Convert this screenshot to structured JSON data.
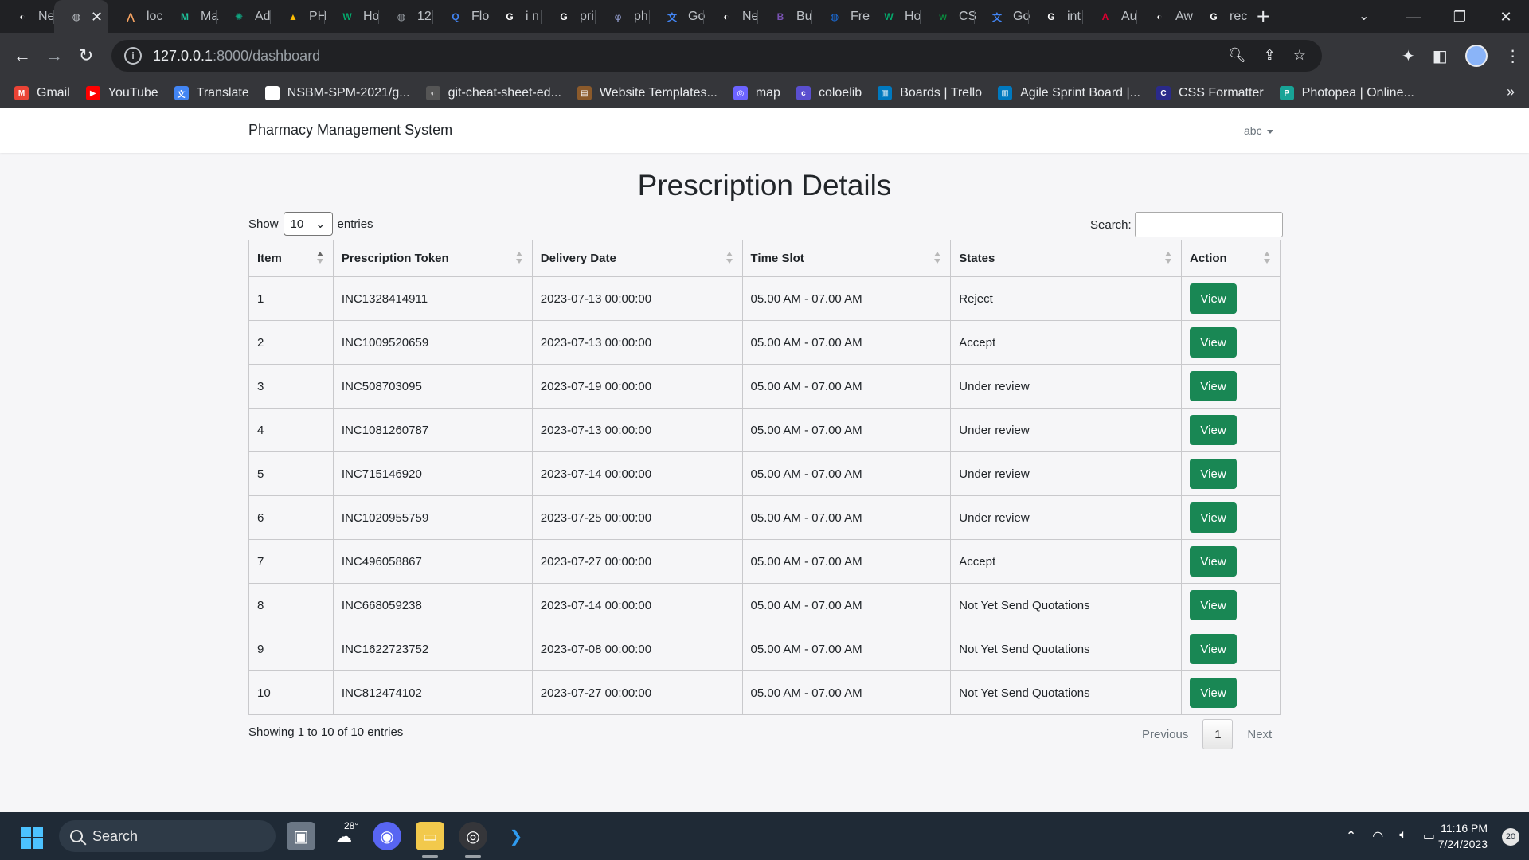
{
  "browser": {
    "tabs": [
      {
        "label": "Ne",
        "icon": "github-icon",
        "color": "#ffffff"
      },
      {
        "label": "",
        "icon": "globe-icon",
        "color": "#bdc1c6",
        "active": true
      },
      {
        "label": "loc",
        "icon": "laravel-icon",
        "color": "#f4a261"
      },
      {
        "label": "Ma",
        "icon": "mailchimp-icon",
        "color": "#1ec19a"
      },
      {
        "label": "Ad",
        "icon": "openai-icon",
        "color": "#10a37f"
      },
      {
        "label": "PH",
        "icon": "drive-icon",
        "color": "#fbbc04"
      },
      {
        "label": "Ho",
        "icon": "w3schools-icon",
        "color": "#04aa6d"
      },
      {
        "label": "12",
        "icon": "globe-icon",
        "color": "#9aa0a6"
      },
      {
        "label": "Flo",
        "icon": "search-icon",
        "color": "#4285f4"
      },
      {
        "label": "i n",
        "icon": "google-icon",
        "color": "#ffffff"
      },
      {
        "label": "pri",
        "icon": "google-icon",
        "color": "#ffffff"
      },
      {
        "label": "ph",
        "icon": "php-icon",
        "color": "#8892bf"
      },
      {
        "label": "Go",
        "icon": "translate-icon",
        "color": "#4285f4"
      },
      {
        "label": "Ne",
        "icon": "github-icon",
        "color": "#ffffff"
      },
      {
        "label": "Bu",
        "icon": "bootstrap-icon",
        "color": "#7952b3"
      },
      {
        "label": "Fre",
        "icon": "blue-globe-icon",
        "color": "#1a73e8"
      },
      {
        "label": "Ho",
        "icon": "w3schools-icon",
        "color": "#04aa6d"
      },
      {
        "label": "CS",
        "icon": "w-icon",
        "color": "#0a8a3e"
      },
      {
        "label": "Go",
        "icon": "translate-icon",
        "color": "#4285f4"
      },
      {
        "label": "int",
        "icon": "google-icon",
        "color": "#ffffff"
      },
      {
        "label": "Au",
        "icon": "angular-icon",
        "color": "#dd0031"
      },
      {
        "label": "Aw",
        "icon": "github-icon",
        "color": "#ffffff"
      },
      {
        "label": "rec",
        "icon": "google-icon",
        "color": "#ffffff"
      }
    ],
    "new_tab_label": "+",
    "url_host": "127.0.0.1",
    "url_path": ":8000/dashboard"
  },
  "bookmarks": [
    {
      "label": "Gmail",
      "icon": "gmail-icon",
      "color": "#ea4335"
    },
    {
      "label": "YouTube",
      "icon": "youtube-icon",
      "color": "#ff0000"
    },
    {
      "label": "Translate",
      "icon": "translate-icon",
      "color": "#4285f4"
    },
    {
      "label": "NSBM-SPM-2021/g...",
      "icon": "github-icon",
      "color": "#ffffff"
    },
    {
      "label": "git-cheat-sheet-ed...",
      "icon": "github-icon",
      "color": "#555555"
    },
    {
      "label": "Website Templates...",
      "icon": "template-icon",
      "color": "#8b5a2b"
    },
    {
      "label": "map",
      "icon": "map-icon",
      "color": "#6c63ff"
    },
    {
      "label": "coloelib",
      "icon": "colorlib-icon",
      "color": "#5a4fcf"
    },
    {
      "label": "Boards | Trello",
      "icon": "trello-icon",
      "color": "#0079bf"
    },
    {
      "label": "Agile Sprint Board |...",
      "icon": "trello-icon",
      "color": "#0079bf"
    },
    {
      "label": "CSS Formatter",
      "icon": "css-tools-icon",
      "color": "#2a2a8a"
    },
    {
      "label": "Photopea | Online...",
      "icon": "photopea-icon",
      "color": "#18a497"
    }
  ],
  "app": {
    "brand": "Pharmacy Management System",
    "user": "abc"
  },
  "page": {
    "title": "Prescription Details",
    "show_label": "Show",
    "entries_label": "entries",
    "page_length": "10",
    "search_label": "Search:",
    "info": "Showing 1 to 10 of 10 entries",
    "prev_label": "Previous",
    "current_page": "1",
    "next_label": "Next",
    "action_label": "View"
  },
  "table": {
    "columns": [
      "Item",
      "Prescription Token",
      "Delivery Date",
      "Time Slot",
      "States",
      "Action"
    ],
    "rows": [
      {
        "item": "1",
        "token": "INC1328414911",
        "date": "2023-07-13 00:00:00",
        "slot": "05.00 AM - 07.00 AM",
        "state": "Reject"
      },
      {
        "item": "2",
        "token": "INC1009520659",
        "date": "2023-07-13 00:00:00",
        "slot": "05.00 AM - 07.00 AM",
        "state": "Accept"
      },
      {
        "item": "3",
        "token": "INC508703095",
        "date": "2023-07-19 00:00:00",
        "slot": "05.00 AM - 07.00 AM",
        "state": "Under review"
      },
      {
        "item": "4",
        "token": "INC1081260787",
        "date": "2023-07-13 00:00:00",
        "slot": "05.00 AM - 07.00 AM",
        "state": "Under review"
      },
      {
        "item": "5",
        "token": "INC715146920",
        "date": "2023-07-14 00:00:00",
        "slot": "05.00 AM - 07.00 AM",
        "state": "Under review"
      },
      {
        "item": "6",
        "token": "INC1020955759",
        "date": "2023-07-25 00:00:00",
        "slot": "05.00 AM - 07.00 AM",
        "state": "Under review"
      },
      {
        "item": "7",
        "token": "INC496058867",
        "date": "2023-07-27 00:00:00",
        "slot": "05.00 AM - 07.00 AM",
        "state": "Accept"
      },
      {
        "item": "8",
        "token": "INC668059238",
        "date": "2023-07-14 00:00:00",
        "slot": "05.00 AM - 07.00 AM",
        "state": "Not Yet Send Quotations"
      },
      {
        "item": "9",
        "token": "INC1622723752",
        "date": "2023-07-08 00:00:00",
        "slot": "05.00 AM - 07.00 AM",
        "state": "Not Yet Send Quotations"
      },
      {
        "item": "10",
        "token": "INC812474102",
        "date": "2023-07-27 00:00:00",
        "slot": "05.00 AM - 07.00 AM",
        "state": "Not Yet Send Quotations"
      }
    ]
  },
  "taskbar": {
    "search_label": "Search",
    "temperature": "28°",
    "time": "11:16 PM",
    "date": "7/24/2023",
    "notifications": "20"
  },
  "colors": {
    "view_button": "#198754",
    "chrome_dark": "#202124",
    "taskbar": "#1f2a36"
  }
}
